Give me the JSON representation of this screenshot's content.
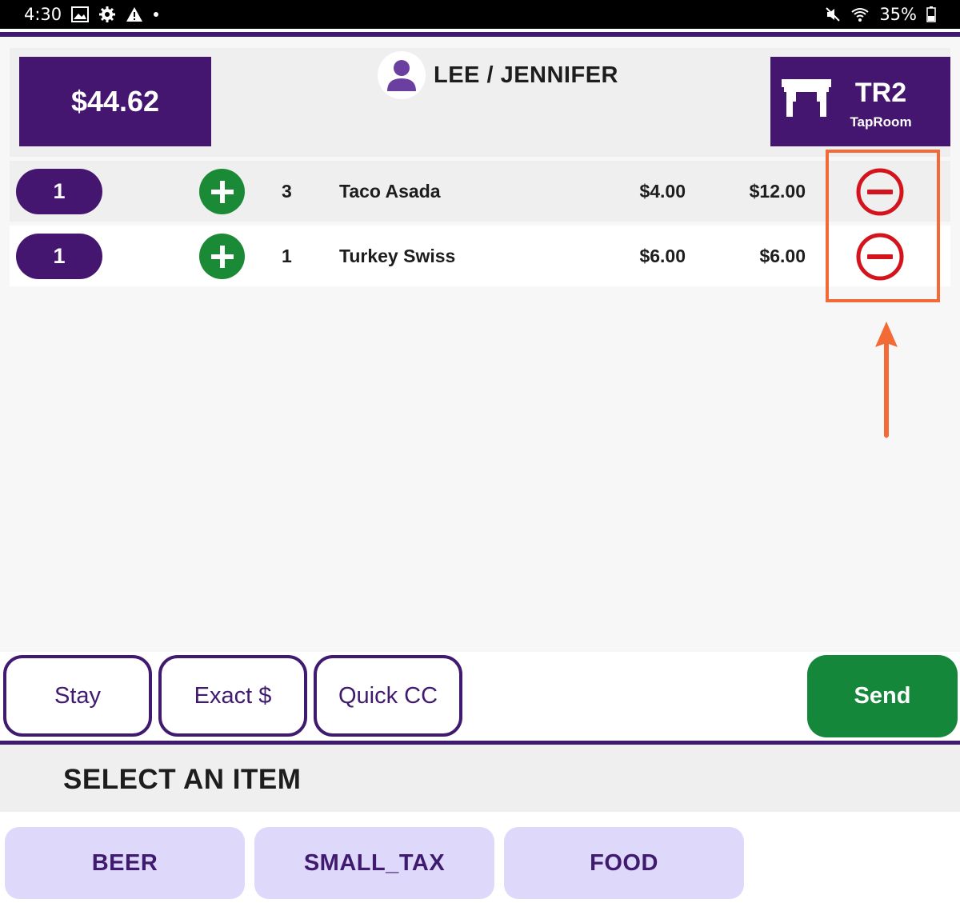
{
  "status_bar": {
    "time": "4:30",
    "battery": "35%",
    "icons_left": [
      "image-icon",
      "gear-icon",
      "warning-icon",
      "dot-icon"
    ],
    "icons_right": [
      "mute-icon",
      "wifi-icon",
      "battery-icon"
    ]
  },
  "header": {
    "total": "$44.62",
    "customer_name": "LEE / JENNIFER",
    "table_code": "TR2",
    "table_area": "TapRoom"
  },
  "order": {
    "items": [
      {
        "seat": "1",
        "qty": "3",
        "name": "Taco Asada",
        "unit_price": "$4.00",
        "line_total": "$12.00"
      },
      {
        "seat": "1",
        "qty": "1",
        "name": "Turkey Swiss",
        "unit_price": "$6.00",
        "line_total": "$6.00"
      }
    ]
  },
  "actions": {
    "stay": "Stay",
    "exact": "Exact $",
    "quick_cc": "Quick CC",
    "send": "Send"
  },
  "categories": {
    "title": "SELECT AN ITEM",
    "items": [
      "BEER",
      "SMALL_TAX",
      "FOOD"
    ]
  },
  "colors": {
    "brand_purple": "#44166f",
    "accent_green": "#14873a",
    "remove_red": "#d4141c",
    "annotation_orange": "#f26a36",
    "category_lavender": "#ded8fb"
  }
}
